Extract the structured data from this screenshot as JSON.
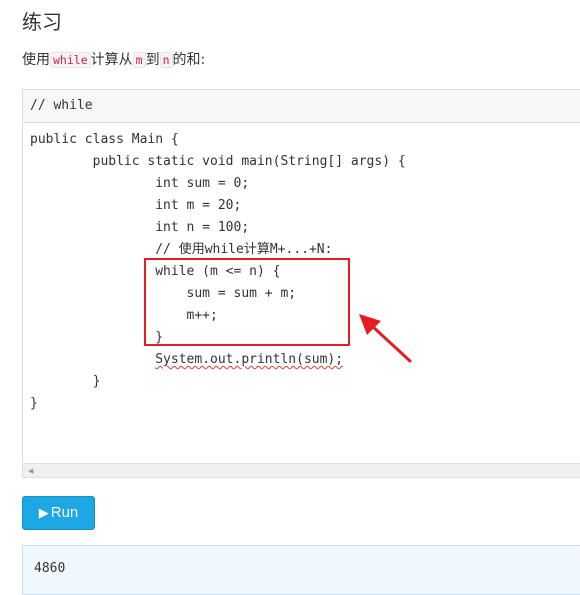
{
  "exercise": {
    "title": "练习",
    "description": {
      "prefix": "使用",
      "keyword": "while",
      "middle1": "计算从",
      "var_m": "m",
      "middle2": "到",
      "var_n": "n",
      "suffix": "的和:"
    }
  },
  "editor": {
    "header_comment": "// while",
    "code_lines": [
      "public class Main {",
      "        public static void main(String[] args) {",
      "                int sum = 0;",
      "                int m = 20;",
      "                int n = 100;",
      "                // 使用while计算M+...+N:",
      "                while (m <= n) {",
      "                    sum = sum + m;",
      "                    m++;",
      "                }",
      "                ",
      "        }",
      "}"
    ],
    "line11_indent": "                ",
    "line11_code": "System.out.println(sum);"
  },
  "run_button": {
    "icon": "play-icon",
    "label": "Run",
    "color": "#1ea7e5"
  },
  "output": {
    "text": "4860"
  },
  "annotation": {
    "color": "#e51c23"
  }
}
